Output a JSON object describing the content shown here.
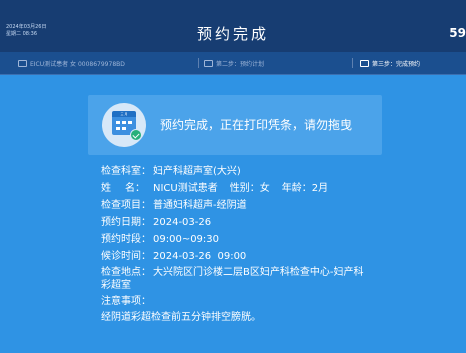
{
  "header": {
    "date": "2024年03月26日",
    "weekday_time": "星期二 08:36",
    "title": "预约完成",
    "countdown": "59"
  },
  "steps": [
    {
      "label": "EICU测试患者  女  0008679978BD"
    },
    {
      "label": "第二步：预约计划"
    },
    {
      "label": "第三步：完成预约"
    }
  ],
  "status": {
    "message": "预约完成，正在打印凭条，请勿拖曳",
    "calendar_header": "三 月"
  },
  "details": {
    "department_label": "检查科室：",
    "department": "妇产科超声室(大兴)",
    "name_label_1": "姓",
    "name_label_2": "名：",
    "name": "NICU测试患者",
    "gender_label": "性别：",
    "gender": "女",
    "age_label": "年龄：",
    "age": "2月",
    "item_label": "检查项目：",
    "item": "普通妇科超声-经阴道",
    "date_label": "预约日期：",
    "date": "2024-03-26",
    "slot_label": "预约时段：",
    "slot": "09:00~09:30",
    "wait_label": "候诊时间：",
    "wait": "2024-03-26  09:00",
    "location_label": "检查地点：",
    "location_line1": "大兴院区门诊楼二层B区妇产科检查中心-妇产科",
    "location_line2": "彩超室",
    "notes_label": "注意事项：",
    "notes": "经阴道彩超检查前五分钟排空膀胱。"
  }
}
